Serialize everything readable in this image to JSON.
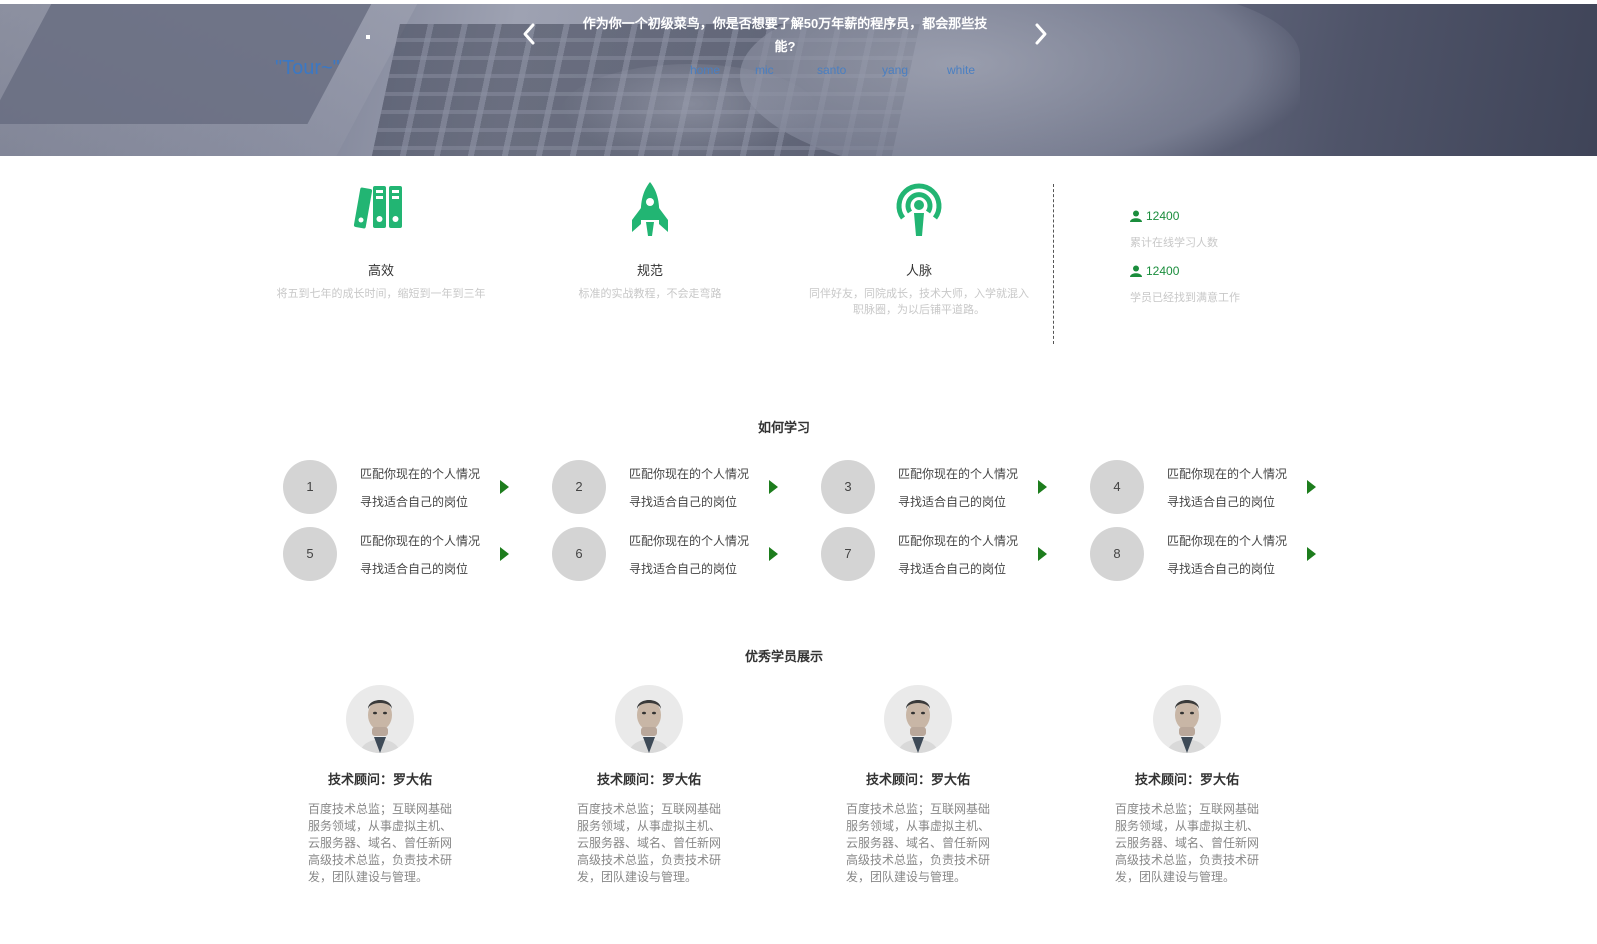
{
  "hero": {
    "dot": "·",
    "tour": "\"Tour~\"",
    "title": "作为你一个初级菜鸟，你是否想要了解50万年薪的程序员，都会那些技能?",
    "nav": [
      "home",
      "mic",
      "santo",
      "yang",
      "white"
    ],
    "prev_icon": "chevron-left-icon",
    "next_icon": "chevron-right-icon"
  },
  "features": [
    {
      "icon": "binders-icon",
      "name": "高效",
      "desc": "将五到七年的成长时间，缩短到一年到三年"
    },
    {
      "icon": "rocket-icon",
      "name": "规范",
      "desc": "标准的实战教程，不会走弯路"
    },
    {
      "icon": "podcast-icon",
      "name": "人脉",
      "desc": "同伴好友，同院成长，技术大师，入学就混入职脉圈，为以后铺平道路。"
    }
  ],
  "stats": [
    {
      "icon": "user-icon",
      "value": "12400",
      "label": "累计在线学习人数"
    },
    {
      "icon": "user-icon",
      "value": "12400",
      "label": "学员已经找到满意工作"
    }
  ],
  "how_to_learn": {
    "title": "如何学习",
    "steps": [
      {
        "num": "1",
        "line1": "匹配你现在的个人情况",
        "line2": "寻找适合自己的岗位"
      },
      {
        "num": "2",
        "line1": "匹配你现在的个人情况",
        "line2": "寻找适合自己的岗位"
      },
      {
        "num": "3",
        "line1": "匹配你现在的个人情况",
        "line2": "寻找适合自己的岗位"
      },
      {
        "num": "4",
        "line1": "匹配你现在的个人情况",
        "line2": "寻找适合自己的岗位"
      },
      {
        "num": "5",
        "line1": "匹配你现在的个人情况",
        "line2": "寻找适合自己的岗位"
      },
      {
        "num": "6",
        "line1": "匹配你现在的个人情况",
        "line2": "寻找适合自己的岗位"
      },
      {
        "num": "7",
        "line1": "匹配你现在的个人情况",
        "line2": "寻找适合自己的岗位"
      },
      {
        "num": "8",
        "line1": "匹配你现在的个人情况",
        "line2": "寻找适合自己的岗位"
      }
    ]
  },
  "students": {
    "title": "优秀学员展示",
    "items": [
      {
        "name": "技术顾问：罗大佑",
        "desc": "百度技术总监；互联网基础服务领域，从事虚拟主机、云服务器、域名、曾任新网高级技术总监，负责技术研发，团队建设与管理。"
      },
      {
        "name": "技术顾问：罗大佑",
        "desc": "百度技术总监；互联网基础服务领域，从事虚拟主机、云服务器、域名、曾任新网高级技术总监，负责技术研发，团队建设与管理。"
      },
      {
        "name": "技术顾问：罗大佑",
        "desc": "百度技术总监；互联网基础服务领域，从事虚拟主机、云服务器、域名、曾任新网高级技术总监，负责技术研发，团队建设与管理。"
      },
      {
        "name": "技术顾问：罗大佑",
        "desc": "百度技术总监；互联网基础服务领域，从事虚拟主机、云服务器、域名、曾任新网高级技术总监，负责技术研发，团队建设与管理。"
      }
    ]
  },
  "colors": {
    "accent": "#22b573",
    "stat": "#1a8d3c",
    "link": "#4a7fc2",
    "arrow": "#1d7d1d"
  }
}
